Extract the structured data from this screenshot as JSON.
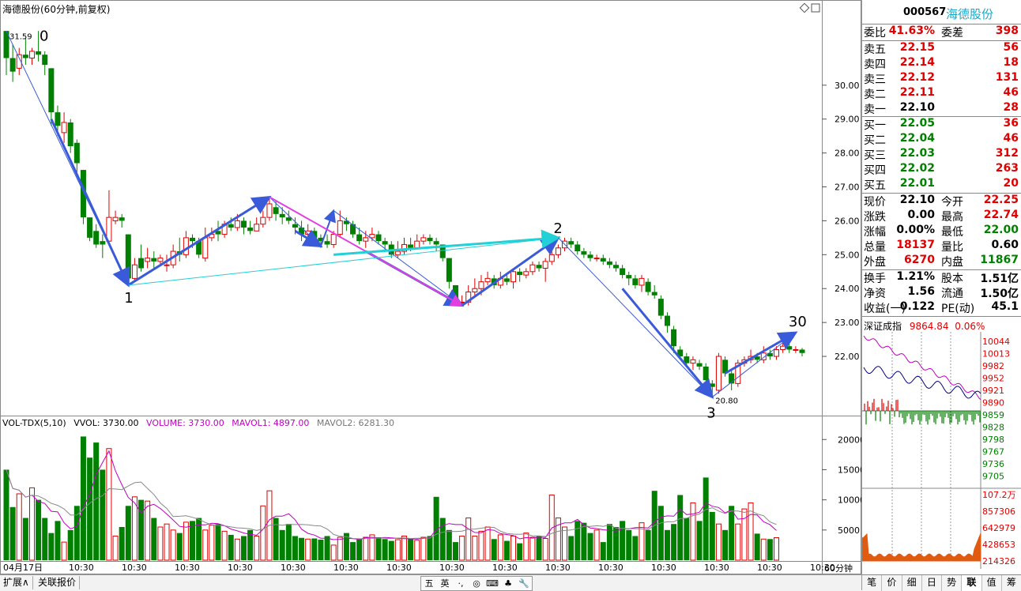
{
  "chart": {
    "title": "海德股份(60分钟,前复权)",
    "volume_header": {
      "indicator": "VOL-TDX(5,10)",
      "vvol": "VVOL: 3730.00",
      "volume": "VOLUME: 3730.00",
      "mavol1": "MAVOL1: 4897.00",
      "mavol2": "MAVOL2: 6281.30"
    },
    "price_axis": [
      "30.00",
      "29.00",
      "28.00",
      "27.00",
      "26.00",
      "25.00",
      "24.00",
      "23.00",
      "22.00"
    ],
    "volume_axis": [
      "20000",
      "15000",
      "10000",
      "5000"
    ],
    "x_labels": [
      "04月17日",
      "10:30",
      "10:30",
      "10:30",
      "10:30",
      "10:30",
      "10:30",
      "10:30",
      "10:30",
      "10:30",
      "10:30",
      "10:30",
      "10:30",
      "10:30",
      "10:30",
      "10:30"
    ],
    "high_label": "31.59",
    "low_label": "20.80",
    "wave_labels": [
      "0",
      "1",
      "2",
      "3",
      "30"
    ],
    "unit_label": "60分钟",
    "colors": {
      "up": "#e00000",
      "down": "#008000",
      "arrow_blue": "#3a5bd9",
      "arrow_cyan": "#22d0d8",
      "arrow_magenta": "#e040e0"
    }
  },
  "chart_data": {
    "type": "candlestick",
    "title": "海德股份(60分钟,前复权)",
    "ylim": [
      20.3,
      32.0
    ],
    "candles": [
      [
        31.6,
        30.8,
        31.6,
        30.3
      ],
      [
        30.8,
        30.4,
        31.2,
        30.1
      ],
      [
        30.5,
        30.9,
        31.1,
        30.3
      ],
      [
        30.9,
        30.8,
        31.4,
        30.6
      ],
      [
        30.8,
        31.0,
        31.1,
        30.6
      ],
      [
        31.0,
        30.9,
        31.6,
        30.7
      ],
      [
        30.9,
        30.6,
        31.0,
        30.3
      ],
      [
        30.5,
        29.2,
        30.5,
        28.8
      ],
      [
        29.2,
        28.8,
        29.4,
        28.5
      ],
      [
        28.6,
        28.9,
        29.2,
        28.3
      ],
      [
        28.9,
        28.2,
        29.0,
        28.0
      ],
      [
        28.3,
        27.7,
        28.4,
        27.3
      ],
      [
        27.5,
        26.1,
        27.5,
        25.9
      ],
      [
        26.1,
        25.5,
        26.1,
        25.4
      ],
      [
        25.7,
        25.3,
        25.9,
        25.2
      ],
      [
        25.4,
        25.3,
        25.6,
        24.9
      ],
      [
        25.4,
        26.1,
        26.9,
        25.3
      ],
      [
        26.0,
        26.1,
        26.3,
        25.9
      ],
      [
        26.1,
        26.0,
        26.2,
        25.8
      ],
      [
        25.6,
        24.3,
        25.6,
        24.1
      ],
      [
        24.3,
        24.7,
        24.9,
        24.2
      ],
      [
        24.9,
        24.6,
        25.3,
        24.5
      ],
      [
        24.8,
        24.9,
        25.2,
        24.6
      ],
      [
        24.9,
        24.8,
        25.1,
        24.6
      ],
      [
        24.8,
        24.9,
        25.0,
        24.7
      ],
      [
        24.7,
        24.7,
        25.0,
        24.5
      ],
      [
        24.7,
        25.1,
        25.3,
        24.6
      ],
      [
        25.1,
        25.0,
        25.5,
        24.8
      ],
      [
        25.0,
        25.5,
        25.7,
        24.9
      ],
      [
        25.5,
        25.4,
        25.6,
        25.2
      ],
      [
        25.4,
        25.0,
        25.5,
        24.9
      ],
      [
        24.9,
        25.5,
        25.8,
        24.8
      ],
      [
        25.5,
        25.6,
        25.8,
        25.4
      ],
      [
        25.7,
        25.6,
        26.0,
        25.4
      ],
      [
        25.6,
        25.9,
        26.0,
        25.5
      ],
      [
        25.9,
        25.8,
        26.1,
        25.7
      ],
      [
        25.8,
        26.0,
        26.2,
        25.7
      ],
      [
        26.0,
        25.8,
        26.1,
        25.6
      ],
      [
        25.8,
        25.7,
        26.0,
        25.6
      ],
      [
        25.7,
        25.9,
        26.1,
        25.7
      ],
      [
        25.9,
        26.1,
        26.3,
        25.8
      ],
      [
        26.1,
        26.5,
        26.7,
        26.0
      ],
      [
        26.4,
        26.2,
        26.6,
        26.0
      ],
      [
        26.2,
        26.1,
        26.4,
        25.9
      ],
      [
        26.1,
        26.0,
        26.3,
        25.9
      ],
      [
        25.9,
        25.8,
        26.1,
        25.6
      ],
      [
        25.8,
        25.6,
        26.0,
        25.4
      ],
      [
        25.6,
        25.7,
        25.9,
        25.4
      ],
      [
        25.7,
        25.5,
        25.8,
        25.3
      ],
      [
        25.5,
        25.4,
        25.6,
        25.2
      ],
      [
        25.4,
        25.3,
        25.6,
        25.2
      ],
      [
        25.3,
        25.6,
        25.7,
        25.2
      ],
      [
        25.6,
        26.0,
        26.3,
        25.5
      ],
      [
        26.0,
        25.9,
        26.1,
        25.7
      ],
      [
        25.9,
        25.6,
        26.0,
        25.5
      ],
      [
        25.6,
        25.4,
        25.8,
        25.3
      ],
      [
        25.4,
        25.5,
        25.7,
        25.2
      ],
      [
        25.5,
        25.6,
        25.8,
        25.4
      ],
      [
        25.6,
        25.4,
        25.7,
        25.3
      ],
      [
        25.4,
        25.3,
        25.5,
        25.1
      ],
      [
        25.3,
        25.0,
        25.4,
        24.9
      ],
      [
        25.0,
        25.1,
        25.4,
        24.9
      ],
      [
        25.1,
        25.3,
        25.5,
        25.0
      ],
      [
        25.3,
        25.2,
        25.5,
        25.1
      ],
      [
        25.2,
        25.4,
        25.6,
        25.2
      ],
      [
        25.4,
        25.5,
        25.6,
        25.3
      ],
      [
        25.5,
        25.4,
        25.6,
        25.3
      ],
      [
        25.4,
        25.3,
        25.5,
        25.1
      ],
      [
        25.3,
        24.9,
        25.3,
        24.8
      ],
      [
        24.9,
        24.2,
        24.9,
        24.0
      ],
      [
        24.1,
        23.6,
        24.1,
        23.5
      ],
      [
        23.6,
        23.6,
        23.8,
        23.5
      ],
      [
        23.6,
        23.9,
        24.1,
        23.5
      ],
      [
        23.9,
        24.0,
        24.3,
        23.8
      ],
      [
        24.0,
        24.2,
        24.4,
        23.8
      ],
      [
        24.2,
        24.3,
        24.5,
        24.1
      ],
      [
        24.3,
        24.1,
        24.4,
        24.0
      ],
      [
        24.1,
        24.3,
        24.5,
        24.0
      ],
      [
        24.3,
        24.2,
        24.4,
        24.1
      ],
      [
        24.2,
        24.5,
        24.6,
        24.0
      ],
      [
        24.5,
        24.4,
        24.6,
        24.2
      ],
      [
        24.4,
        24.5,
        24.6,
        24.3
      ],
      [
        24.5,
        24.7,
        24.8,
        24.4
      ],
      [
        24.7,
        24.6,
        24.8,
        24.5
      ],
      [
        24.6,
        24.8,
        24.9,
        24.2
      ],
      [
        24.8,
        25.0,
        25.2,
        24.7
      ],
      [
        25.0,
        25.2,
        25.3,
        24.9
      ],
      [
        25.2,
        25.4,
        25.5,
        25.1
      ],
      [
        25.4,
        25.3,
        25.5,
        25.2
      ],
      [
        25.3,
        25.1,
        25.4,
        25.0
      ],
      [
        25.1,
        25.0,
        25.2,
        24.9
      ],
      [
        25.0,
        24.9,
        25.1,
        24.8
      ],
      [
        24.9,
        24.9,
        25.0,
        24.8
      ],
      [
        24.9,
        24.8,
        25.0,
        24.7
      ],
      [
        24.8,
        24.7,
        24.9,
        24.6
      ],
      [
        24.7,
        24.6,
        24.8,
        24.5
      ],
      [
        24.6,
        24.4,
        24.7,
        24.3
      ],
      [
        24.4,
        24.3,
        24.5,
        24.1
      ],
      [
        24.3,
        24.1,
        24.4,
        24.0
      ],
      [
        24.1,
        24.3,
        24.4,
        23.9
      ],
      [
        24.2,
        23.9,
        24.3,
        23.8
      ],
      [
        23.9,
        23.8,
        24.1,
        23.7
      ],
      [
        23.7,
        23.2,
        23.8,
        23.1
      ],
      [
        23.2,
        22.9,
        23.3,
        22.7
      ],
      [
        22.8,
        22.3,
        22.9,
        22.1
      ],
      [
        22.2,
        22.0,
        22.3,
        21.9
      ],
      [
        22.0,
        21.8,
        22.1,
        21.7
      ],
      [
        21.8,
        21.9,
        22.0,
        21.6
      ],
      [
        21.8,
        21.7,
        21.9,
        21.6
      ],
      [
        21.7,
        21.3,
        21.8,
        21.2
      ],
      [
        21.2,
        21.1,
        21.3,
        20.8
      ],
      [
        21.0,
        22.0,
        22.1,
        20.9
      ],
      [
        21.9,
        21.5,
        22.0,
        21.4
      ],
      [
        21.5,
        21.2,
        21.6,
        21.0
      ],
      [
        21.2,
        21.8,
        21.9,
        21.1
      ],
      [
        21.8,
        21.9,
        22.0,
        21.7
      ],
      [
        21.9,
        22.0,
        22.2,
        21.8
      ],
      [
        22.0,
        21.9,
        22.1,
        21.8
      ],
      [
        21.9,
        22.1,
        22.3,
        21.8
      ],
      [
        22.1,
        22.0,
        22.2,
        21.9
      ],
      [
        22.0,
        22.2,
        22.3,
        21.9
      ],
      [
        22.2,
        22.3,
        22.7,
        22.1
      ],
      [
        22.3,
        22.2,
        22.4,
        22.1
      ],
      [
        22.2,
        22.2,
        22.3,
        22.1
      ],
      [
        22.2,
        22.1,
        22.25,
        22.0
      ]
    ],
    "volume": [
      15000,
      8800,
      11000,
      7000,
      12000,
      10000,
      7000,
      4500,
      6500,
      3000,
      5000,
      9000,
      20500,
      17000,
      19500,
      15000,
      18500,
      4000,
      5500,
      9000,
      10500,
      10000,
      9800,
      7000,
      5500,
      6000,
      5000,
      4500,
      6300,
      6500,
      7000,
      5000,
      5800,
      6000,
      4800,
      4200,
      3500,
      4000,
      5000,
      4000,
      9000,
      11500,
      7000,
      5000,
      6000,
      4000,
      3700,
      3500,
      3600,
      3400,
      4000,
      2500,
      3800,
      4500,
      3000,
      3500,
      3800,
      4200,
      3800,
      3500,
      3200,
      3400,
      4000,
      3600,
      3300,
      3800,
      4000,
      10500,
      7000,
      5000,
      3000,
      4000,
      7000,
      4000,
      4800,
      5500,
      3500,
      4200,
      3200,
      4000,
      2800,
      4500,
      3800,
      4000,
      3600,
      10800,
      7000,
      5500,
      4000,
      6500,
      6200,
      4500,
      5000,
      3000,
      6000,
      5500,
      6500,
      5000,
      4000,
      6200,
      5000,
      11500,
      9000,
      5000,
      6000,
      10800,
      7000,
      9500,
      6500,
      13700,
      8000,
      6000,
      5000,
      9000,
      6000,
      8500,
      9500,
      4400,
      3500,
      3500,
      3730
    ],
    "price_axis_range": [
      22.0,
      30.0
    ],
    "volume_axis_range": [
      0,
      20000
    ],
    "annotations": {
      "high": 31.59,
      "low": 20.8
    }
  },
  "quote": {
    "code": "000567",
    "name": "海德股份",
    "weibi": {
      "label": "委比",
      "value": "41.63%",
      "label2": "委差",
      "value2": "398"
    },
    "asks": [
      {
        "label": "卖五",
        "price": "22.15",
        "vol": "56"
      },
      {
        "label": "卖四",
        "price": "22.14",
        "vol": "18"
      },
      {
        "label": "卖三",
        "price": "22.12",
        "vol": "131"
      },
      {
        "label": "卖二",
        "price": "22.11",
        "vol": "46"
      },
      {
        "label": "卖一",
        "price": "22.10",
        "vol": "28"
      }
    ],
    "bids": [
      {
        "label": "买一",
        "price": "22.05",
        "vol": "36"
      },
      {
        "label": "买二",
        "price": "22.04",
        "vol": "46"
      },
      {
        "label": "买三",
        "price": "22.03",
        "vol": "312"
      },
      {
        "label": "买四",
        "price": "22.02",
        "vol": "263"
      },
      {
        "label": "买五",
        "price": "22.01",
        "vol": "20"
      }
    ],
    "stats1": [
      {
        "l": "现价",
        "v": "22.10",
        "vc": "blk",
        "l2": "今开",
        "v2": "22.25",
        "v2c": "red"
      },
      {
        "l": "涨跌",
        "v": "0.00",
        "vc": "blk",
        "l2": "最高",
        "v2": "22.74",
        "v2c": "red"
      },
      {
        "l": "涨幅",
        "v": "0.00%",
        "vc": "blk",
        "l2": "最低",
        "v2": "22.00",
        "v2c": "grn"
      },
      {
        "l": "总量",
        "v": "18137",
        "vc": "red",
        "l2": "量比",
        "v2": "0.60",
        "v2c": "blk"
      },
      {
        "l": "外盘",
        "v": "6270",
        "vc": "red",
        "l2": "内盘",
        "v2": "11867",
        "v2c": "grn"
      }
    ],
    "stats2": [
      {
        "l": "换手",
        "v": "1.21%",
        "l2": "股本",
        "v2": "1.51亿"
      },
      {
        "l": "净资",
        "v": "1.56",
        "l2": "流通",
        "v2": "1.50亿"
      },
      {
        "l": "收益(一)",
        "v": "0.122",
        "l2": "PE(动)",
        "v2": "45.1"
      }
    ],
    "index": {
      "name": "深证成指",
      "value": "9864.84",
      "pct": "0.06%"
    },
    "index_axis": [
      "10044",
      "10013",
      "9982",
      "9952",
      "9921",
      "9890",
      "9859",
      "9828",
      "9798",
      "9767",
      "9736",
      "9705"
    ],
    "index_vol_axis": [
      "107.2万",
      "857306",
      "642979",
      "428653",
      "214326"
    ],
    "bottom_tabs": [
      "笔",
      "价",
      "细",
      "日",
      "势",
      "联",
      "值",
      "筹"
    ]
  },
  "bottom": {
    "tabs": [
      "扩展∧",
      "关联报价"
    ],
    "ime": [
      "五",
      "英",
      "·,",
      "◎",
      "⌨",
      "♣",
      "🔧"
    ]
  }
}
